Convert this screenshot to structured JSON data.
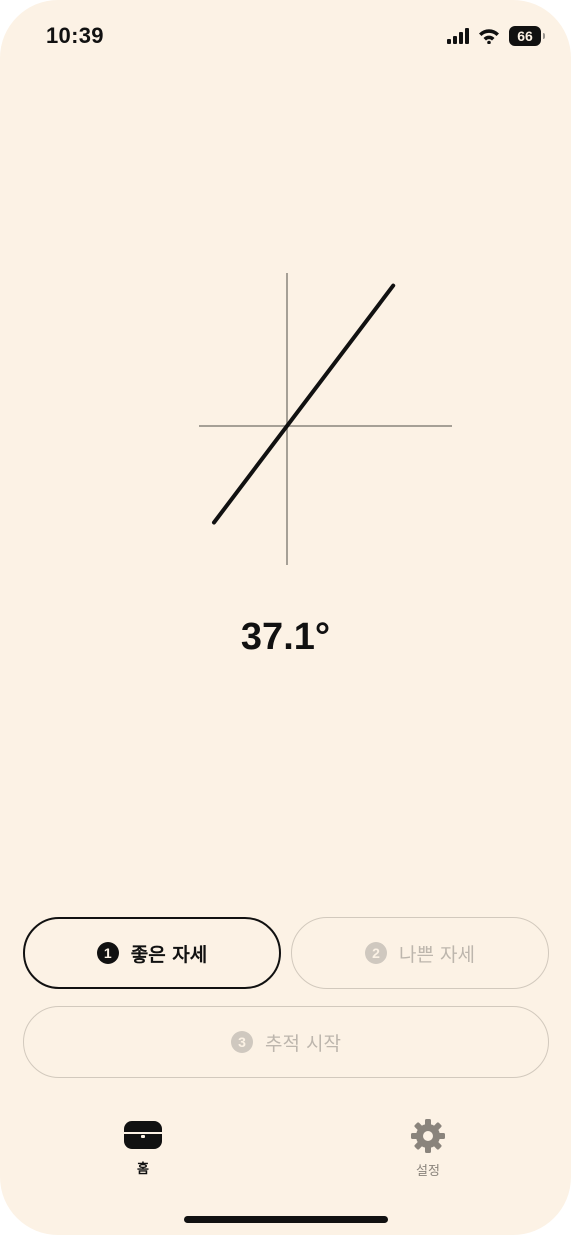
{
  "status_bar": {
    "time": "10:39",
    "battery_level": "66",
    "icons": [
      "cellular-signal-icon",
      "wifi-icon",
      "battery-icon"
    ]
  },
  "angle": {
    "value_text": "37.1°",
    "degrees": 37.1
  },
  "buttons": {
    "good_posture": {
      "step": "1",
      "label": "좋은 자세",
      "state": "active"
    },
    "bad_posture": {
      "step": "2",
      "label": "나쁜 자세",
      "state": "disabled"
    },
    "start_tracking": {
      "step": "3",
      "label": "추적 시작",
      "state": "disabled"
    }
  },
  "tab_bar": {
    "home": {
      "label": "홈",
      "icon": "home-case-icon",
      "selected": true
    },
    "settings": {
      "label": "설정",
      "icon": "gear-icon",
      "selected": false
    }
  },
  "colors": {
    "background": "#fcf2e5",
    "primary": "#111111",
    "disabled_text": "#bdb6ad",
    "disabled_border": "#d2c9bd",
    "tab_inactive": "#8a847c"
  }
}
